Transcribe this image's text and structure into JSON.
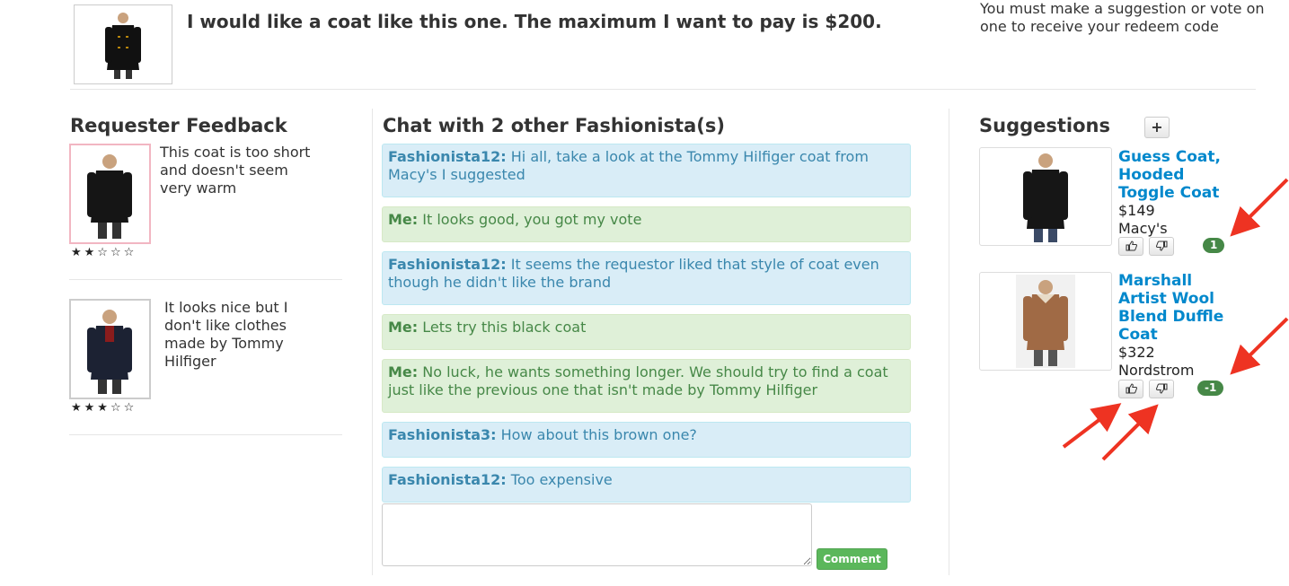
{
  "request": {
    "text": "I would like a coat like this one. The maximum I want to pay is $200.",
    "notice": "You must make a suggestion or vote on one to receive your redeem code"
  },
  "feedback": {
    "heading": "Requester Feedback",
    "items": [
      {
        "text": "This coat is too short and doesn't seem very warm",
        "rating": 2,
        "stars": "★★☆☆☆"
      },
      {
        "text": "It looks nice but I don't like clothes made by Tommy Hilfiger",
        "rating": 3,
        "stars": "★★★☆☆"
      }
    ]
  },
  "chat": {
    "heading": "Chat with 2 other Fashionista(s)",
    "messages": [
      {
        "author": "Fashionista12:",
        "text": " Hi all, take a look at the Tommy Hilfiger coat from Macy's I suggested",
        "type": "other"
      },
      {
        "author": "Me:",
        "text": " It looks good, you got my vote",
        "type": "me"
      },
      {
        "author": "Fashionista12:",
        "text": " It seems the requestor liked that style of coat even though he didn't like the brand",
        "type": "other"
      },
      {
        "author": "Me:",
        "text": " Lets try this black coat",
        "type": "me"
      },
      {
        "author": "Me:",
        "text": " No luck, he wants something longer. We should try to find a coat just like the previous one that isn't made by Tommy Hilfiger",
        "type": "me"
      },
      {
        "author": "Fashionista3:",
        "text": " How about this brown one?",
        "type": "other"
      },
      {
        "author": "Fashionista12:",
        "text": " Too expensive",
        "type": "other"
      }
    ],
    "comment_button": "Comment"
  },
  "suggestions": {
    "heading": "Suggestions",
    "add_label": "+",
    "items": [
      {
        "title": "Guess Coat, Hooded Toggle Coat",
        "price": "$149",
        "store": "Macy's",
        "votes": "1"
      },
      {
        "title": "Marshall Artist Wool Blend Duffle Coat",
        "price": "$322",
        "store": "Nordstrom",
        "votes": "-1"
      }
    ]
  },
  "colors": {
    "other_msg_bg": "#d9edf7",
    "me_msg_bg": "#dff0d8",
    "link": "#0088cc",
    "badge": "#468847",
    "arrow": "#ee3322"
  }
}
